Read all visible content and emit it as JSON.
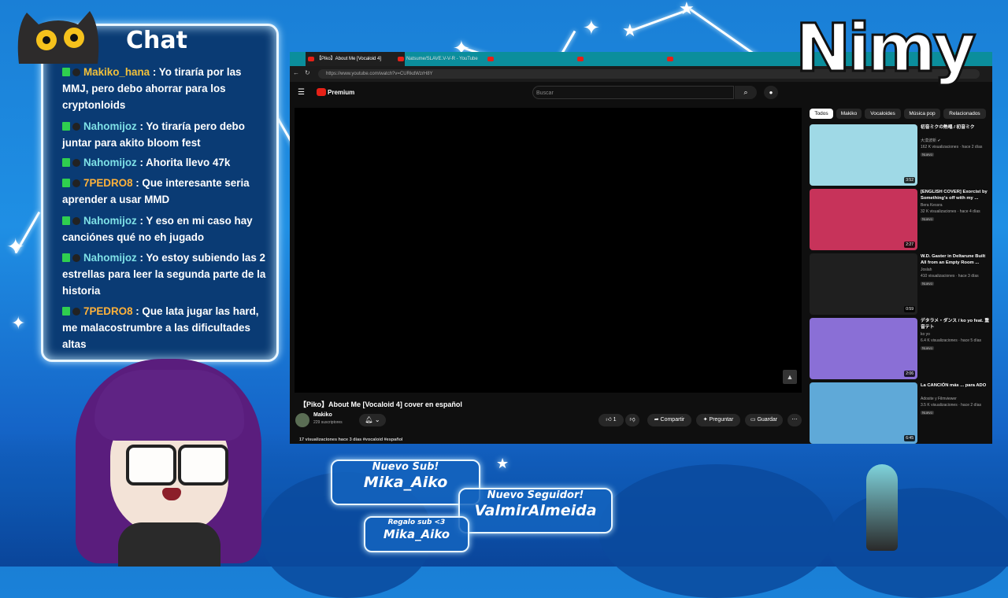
{
  "chat": {
    "title": "Chat",
    "messages": [
      {
        "user": "Makiko_hana",
        "color": "pink",
        "text": ": Yo tiraría por las MMJ, pero debo ahorrar para los cryptonloids"
      },
      {
        "user": "Nahomijoz",
        "color": "teal",
        "text": ": Yo tiraría pero debo juntar para akito bloom fest"
      },
      {
        "user": "Nahomijoz",
        "color": "teal",
        "text": ": Ahorita llevo 47k"
      },
      {
        "user": "7PEDRO8",
        "color": "orange",
        "text": ": Que interesante seria aprender a usar MMD"
      },
      {
        "user": "Nahomijoz",
        "color": "teal",
        "text": ": Y eso en mi caso hay canciónes qué no eh jugado"
      },
      {
        "user": "Nahomijoz",
        "color": "teal",
        "text": ": Yo estoy subiendo las 2 estrellas para leer la segunda parte de la historia"
      },
      {
        "user": "7PEDRO8",
        "color": "orange",
        "text": ": Que lata jugar las hard, me malacostrumbre a las dificultades altas"
      }
    ]
  },
  "browser": {
    "tabs": [
      {
        "label": "【Piko】About Me [Vocaloid 4]",
        "active": true
      },
      {
        "label": "Natsume/SLAVE.V-V-R - YouTube",
        "active": false
      },
      {
        "label": "",
        "active": false
      },
      {
        "label": "",
        "active": false
      },
      {
        "label": "",
        "active": false
      }
    ],
    "url": "https://www.youtube.com/watch?v=CURkdWzrH8Y",
    "premium_label": "Premium",
    "search_placeholder": "Buscar",
    "video": {
      "title": "【Piko】About Me [Vocaloid 4] cover en español",
      "channel": "Makiko",
      "subscribers": "229 suscriptores",
      "likes": "1",
      "share_label": "Compartir",
      "ask_label": "Preguntar",
      "save_label": "Guardar",
      "meta": "17 visualizaciones  hace 3 días  #vocaloid #español"
    },
    "chips": [
      "Todos",
      "Makiko",
      "Vocaloides",
      "Música pop",
      "Relacionados"
    ],
    "recommendations": [
      {
        "title": "初音ミクの熱唱 / 初音ミク",
        "channel": "大漠波新 ✔",
        "meta": "162 K visualizaciones · hace 2 días",
        "badge": "Nuevo",
        "duration": "3:52",
        "color": "#9fd9e6"
      },
      {
        "title": "[ENGLISH COVER] Exorcist by Something's off with my ...",
        "channel": "Bera Kessra",
        "meta": "32 K visualizaciones · hace 4 días",
        "badge": "Nuevo",
        "duration": "2:27",
        "color": "#c7335a"
      },
      {
        "title": "W.D. Gaster in Deltarune Built All from an Empty Room ...",
        "channel": "Joslah",
        "meta": "410 visualizaciones · hace 3 días",
        "badge": "Nuevo",
        "duration": "0:59",
        "color": "#1f1f1f"
      },
      {
        "title": "デタラメ・ダンス / ko yo feat. 重音テト",
        "channel": "ko yo",
        "meta": "6.4 K visualizaciones · hace 5 días",
        "badge": "Nuevo",
        "duration": "2:06",
        "color": "#8a6fd6"
      },
      {
        "title": "La CANCIÓN más ... para ADO",
        "channel": "Adosite y Filmviewer",
        "meta": "3.5 K visualizaciones · hace 2 días",
        "badge": "Nuevo",
        "duration": "6:45",
        "color": "#5fa9d8"
      }
    ]
  },
  "branding": {
    "logo": "Nimy"
  },
  "alerts": [
    {
      "heading": "Nuevo Sub!",
      "name": "Mika_Aiko"
    },
    {
      "heading": "Nuevo Seguidor!",
      "name": "ValmirAlmeida"
    },
    {
      "heading": "Regalo sub <3",
      "name": "Mika_Aiko"
    }
  ],
  "colors": {
    "bg": "#1a7fd6",
    "chat_bg": "#0a3b74",
    "pink": "#f2c03a",
    "teal": "#7ee0e6",
    "orange": "#ffb23a",
    "yt_red": "#e62117"
  }
}
